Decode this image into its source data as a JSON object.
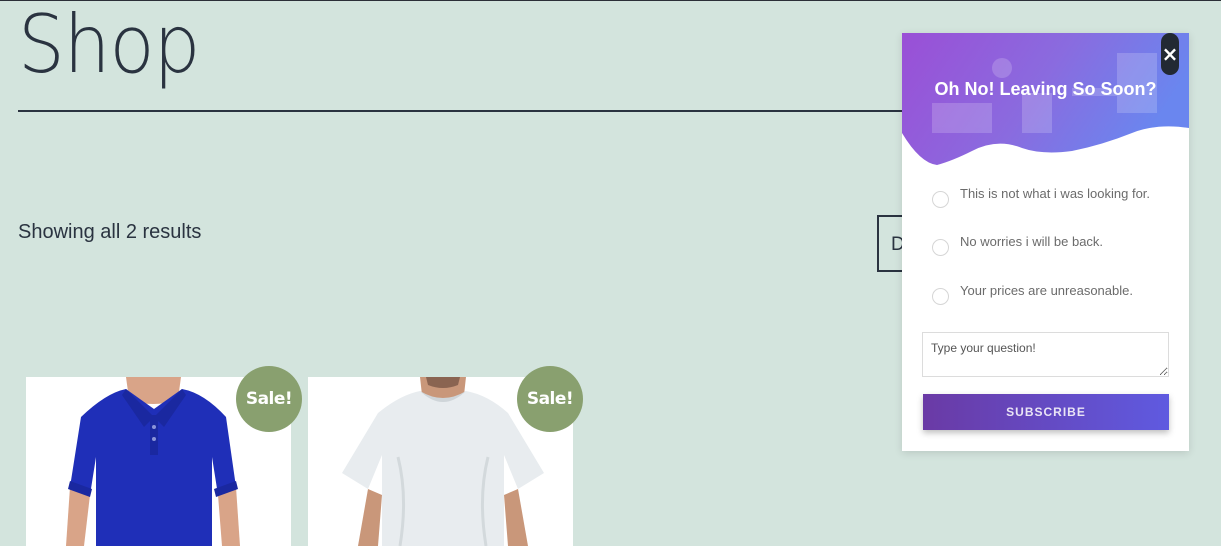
{
  "page": {
    "title": "Shop",
    "result_count": "Showing all 2 results",
    "orderby_visible_text": "D"
  },
  "products": [
    {
      "badge": "Sale!",
      "image": "blue-polo-shirt"
    },
    {
      "badge": "Sale!",
      "image": "white-t-shirt"
    }
  ],
  "popup": {
    "title": "Oh No! Leaving So Soon?",
    "close_icon": "×",
    "options": [
      "This is not what i was looking for.",
      "No worries i will be back.",
      "Your prices are unreasonable."
    ],
    "question_placeholder": "Type your question!",
    "subscribe_label": "SUBSCRIBE"
  },
  "colors": {
    "background": "#d3e4dd",
    "sale_badge": "#89a06f",
    "popup_gradient_start": "#9a4fd6",
    "popup_gradient_end": "#6a86ef",
    "button_gradient_start": "#6a3aa5",
    "button_gradient_end": "#5f5ae0"
  }
}
